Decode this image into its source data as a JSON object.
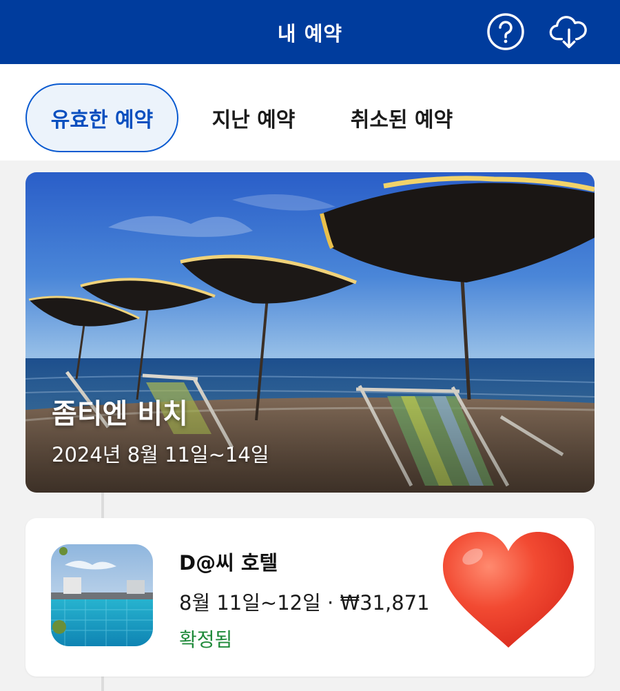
{
  "header": {
    "title": "내 예약",
    "help_icon": "question-circle-icon",
    "sync_icon": "cloud-download-icon",
    "bar_color": "#003c9d"
  },
  "tabs": [
    {
      "label": "유효한 예약",
      "active": true
    },
    {
      "label": "지난 예약",
      "active": false
    },
    {
      "label": "취소된 예약",
      "active": false
    }
  ],
  "trip": {
    "name": "좀티엔 비치",
    "dates": "2024년 8월 11일~14일"
  },
  "booking": {
    "hotel_name": "D@씨 호텔",
    "details": "8월 11일~12일 · ₩31,871",
    "status": "확정됨",
    "status_color": "#1f8a3a",
    "favorite_icon": "heart-icon"
  }
}
